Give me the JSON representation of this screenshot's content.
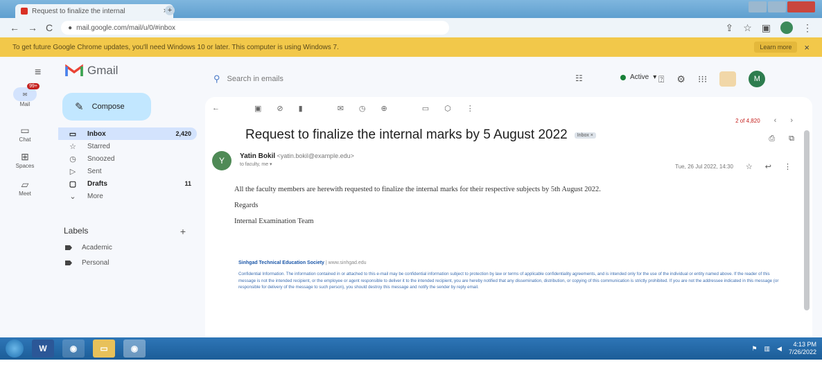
{
  "browser": {
    "tab_title": "Request to finalize the internal",
    "tab_close": "×",
    "new_tab": "+",
    "address": "mail.google.com/mail/u/0/#inbox",
    "nav_back": "←",
    "nav_forward": "→",
    "nav_reload": "C",
    "icons": {
      "share": "⇪",
      "star": "☆",
      "sidebar": "▣"
    }
  },
  "infobar": {
    "message": "To get future Google Chrome updates, you'll need Windows 10 or later. This computer is using Windows 7.",
    "button_label": "Learn more",
    "close": "×"
  },
  "gmail": {
    "app_name": "Gmail",
    "search_placeholder": "Search in emails",
    "status_label": "Active",
    "status_caret": "▾",
    "compose_label": "Compose",
    "avatar_initial": "M",
    "rail": [
      {
        "label": "Mail",
        "badge": "99+"
      },
      {
        "label": "Chat"
      },
      {
        "label": "Spaces"
      },
      {
        "label": "Meet"
      }
    ],
    "folders": [
      {
        "label": "Inbox",
        "count": "2,420",
        "icon": "inbox-icon",
        "glyph": "▭"
      },
      {
        "label": "Starred",
        "count": "",
        "icon": "star-icon",
        "glyph": "☆"
      },
      {
        "label": "Snoozed",
        "count": "",
        "icon": "clock-icon",
        "glyph": "◷"
      },
      {
        "label": "Sent",
        "count": "",
        "icon": "send-icon",
        "glyph": "▷"
      },
      {
        "label": "Drafts",
        "count": "11",
        "icon": "draft-icon",
        "glyph": "▢"
      },
      {
        "label": "More",
        "count": "",
        "icon": "chevron-down-icon",
        "glyph": "⌄"
      }
    ],
    "labels_heading": "Labels",
    "labels_add": "+",
    "labels": [
      {
        "label": "Academic"
      },
      {
        "label": "Personal"
      }
    ]
  },
  "message": {
    "pager": "2 of 4,820",
    "subject": "Request to finalize the internal marks by 5 August 2022",
    "subject_chip": "Inbox ×",
    "sender_initial": "Y",
    "sender_name": "Yatin Bokil",
    "sender_email": "<yatin.bokil@example.edu>",
    "to_line": "to faculty, me ▾",
    "date": "Tue, 26 Jul 2022, 14:30",
    "body_line1": "All the faculty members are herewith requested to finalize the internal marks for their respective subjects by 5th August 2022.",
    "body_regards": "Regards",
    "body_team": "Internal Examination Team",
    "signature_org": "Sinhgad Technical Education Society",
    "signature_site": "| www.sinhgad.edu",
    "disclaimer": "Confidential Information. The information contained in or attached to this e-mail may be confidential information subject to protection by law or terms of applicable confidentiality agreements, and is intended only for the use of the individual or entity named above. If the reader of this message is not the intended recipient, or the employee or agent responsible to deliver it to the intended recipient, you are hereby notified that any dissemination, distribution, or copying of this communication is strictly prohibited. If you are not the addressee indicated in this message (or responsible for delivery of the message to such person), you should destroy this message and notify the sender by reply email."
  },
  "taskbar": {
    "time": "4:13 PM",
    "date": "7/26/2022"
  },
  "colors": {
    "infobar": "#f2c84a",
    "compose": "#c2e7ff",
    "inbox_active": "#d3e3fd",
    "active_status": "#188038",
    "taskbar": "#1c5d98"
  }
}
